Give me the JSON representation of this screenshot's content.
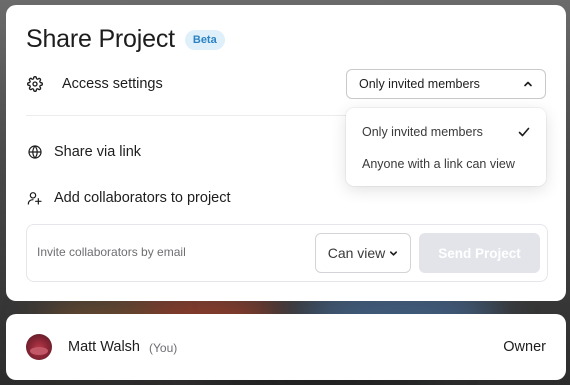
{
  "modal": {
    "title": "Share Project",
    "badge": "Beta"
  },
  "access": {
    "label": "Access settings",
    "icon": "gear-icon",
    "selected": "Only invited members"
  },
  "dropdown": {
    "options": [
      {
        "label": "Only invited members",
        "selected": true
      },
      {
        "label": "Anyone with a link can view",
        "selected": false
      }
    ]
  },
  "share_link": {
    "label": "Share via link",
    "icon": "globe-icon"
  },
  "collaborators": {
    "label": "Add collaborators to project",
    "icon": "add-user-icon"
  },
  "invite": {
    "placeholder": "Invite collaborators by email",
    "permission": "Can view",
    "send_label": "Send Project"
  },
  "members": [
    {
      "name": "Matt Walsh",
      "tag": "(You)",
      "role": "Owner"
    }
  ]
}
